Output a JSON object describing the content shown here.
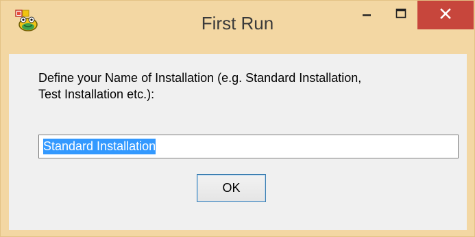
{
  "window": {
    "title": "First Run",
    "app_icon": "frog-app-icon",
    "controls": {
      "minimize_icon": "minimize-icon",
      "maximize_icon": "maximize-icon",
      "close_icon": "close-icon"
    },
    "colors": {
      "frame": "#f3d7a3",
      "close_button": "#c7463c",
      "content_background": "#f0f0f0",
      "selection": "#3399ff"
    }
  },
  "dialog": {
    "prompt_line1": "Define your Name of Installation (e.g. Standard Installation,",
    "prompt_line2": "Test Installation etc.):",
    "name_input": {
      "value": "Standard Installation"
    },
    "ok_label": "OK"
  }
}
